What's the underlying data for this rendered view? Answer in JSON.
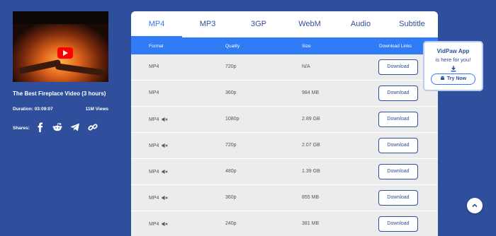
{
  "video": {
    "title": "The Best Fireplace Video (3 hours)",
    "duration": "Duration: 03:09:07",
    "views": "11M Views",
    "shares_label": "Shares:"
  },
  "tabs": [
    "MP4",
    "MP3",
    "3GP",
    "WebM",
    "Audio",
    "Subtitle"
  ],
  "table": {
    "headers": {
      "format": "Format",
      "quality": "Quality",
      "size": "Size",
      "download": "Download Links"
    },
    "button_label": "Download",
    "rows": [
      {
        "format": "MP4",
        "quality": "720p",
        "size": "N/A",
        "muted": false
      },
      {
        "format": "MP4",
        "quality": "360p",
        "size": "984 MB",
        "muted": false
      },
      {
        "format": "MP4",
        "quality": "1080p",
        "size": "2.89 GB",
        "muted": true
      },
      {
        "format": "MP4",
        "quality": "720p",
        "size": "2.07 GB",
        "muted": true
      },
      {
        "format": "MP4",
        "quality": "480p",
        "size": "1.39 GB",
        "muted": true
      },
      {
        "format": "MP4",
        "quality": "360p",
        "size": "855 MB",
        "muted": true
      },
      {
        "format": "MP4",
        "quality": "240p",
        "size": "381 MB",
        "muted": true
      }
    ]
  },
  "promo": {
    "title": "VidPaw App",
    "subtitle": "is here for you!",
    "button": "Try Now"
  },
  "colors": {
    "background": "#2f4f9c",
    "accent": "#2f7cf6",
    "row_bg": "#ececec"
  }
}
